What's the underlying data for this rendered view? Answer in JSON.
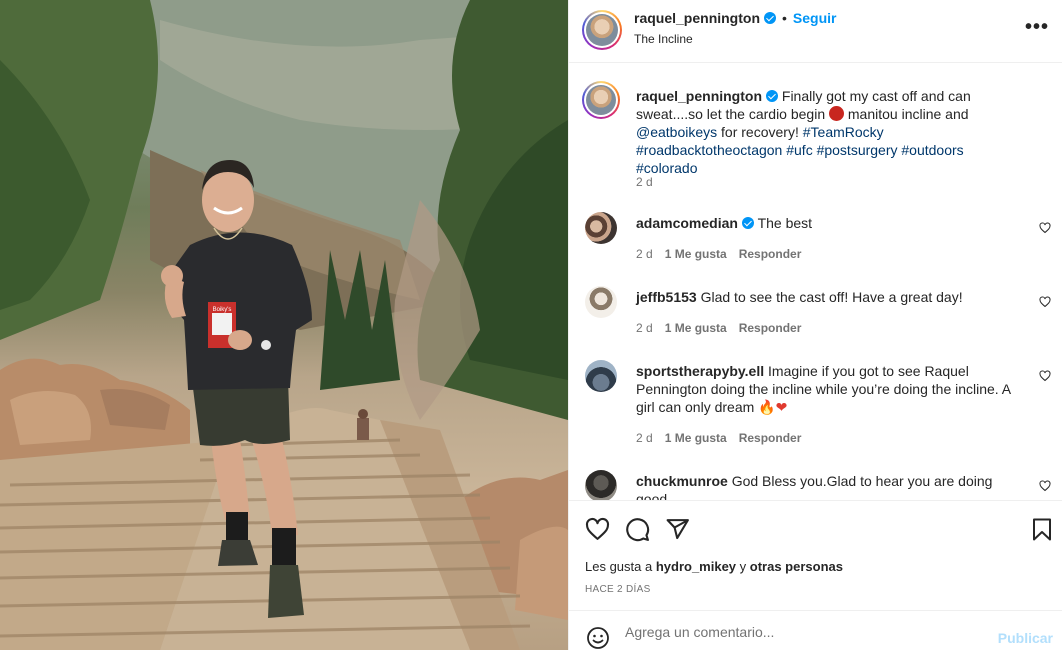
{
  "post": {
    "author": "raquel_pennington",
    "follow_label": "Seguir",
    "location": "The Incline",
    "more_label": "•••",
    "caption": {
      "part1": "Finally got my cast off and can sweat....so let the cardio begin ",
      "part2": " manitou incline and ",
      "mention": "@eatboikeys",
      "part3": " for recovery! ",
      "hashtags": "#TeamRocky #roadbacktotheoctagon #ufc #postsurgery #outdoors #colorado",
      "emoji_name": "angry-face-emoji",
      "age": "2 d"
    },
    "photo_card_text": "Boiky's"
  },
  "comments": [
    {
      "user": "adamcomedian",
      "verified": true,
      "text": "The best",
      "age": "2 d",
      "likes": "1 Me gusta",
      "reply": "Responder"
    },
    {
      "user": "jeffb5153",
      "verified": false,
      "text": "Glad to see the cast off! Have a great day!",
      "age": "2 d",
      "likes": "1 Me gusta",
      "reply": "Responder"
    },
    {
      "user": "sportstherapyby.ell",
      "verified": false,
      "text": "Imagine if you got to see Raquel Pennington doing the incline while you’re doing the incline. A girl can only dream ",
      "text_emoji": "🔥❤",
      "age": "2 d",
      "likes": "1 Me gusta",
      "reply": "Responder"
    },
    {
      "user": "chuckmunroe",
      "verified": false,
      "text": "God Bless you.Glad to hear you are doing good."
    }
  ],
  "actions": {
    "icons": [
      "heart-icon",
      "comment-icon",
      "share-icon",
      "bookmark-icon"
    ],
    "likes_prefix": "Les gusta a ",
    "likes_user": "hydro_mikey",
    "likes_mid": " y ",
    "likes_suffix": "otras personas",
    "timestamp": "HACE 2 DÍAS"
  },
  "add_comment": {
    "placeholder": "Agrega un comentario...",
    "publish_label": "Publicar"
  },
  "colors": {
    "accent": "#0095f6",
    "text": "#262626",
    "secondary": "#737373",
    "publish_disabled": "#b2dffc"
  }
}
